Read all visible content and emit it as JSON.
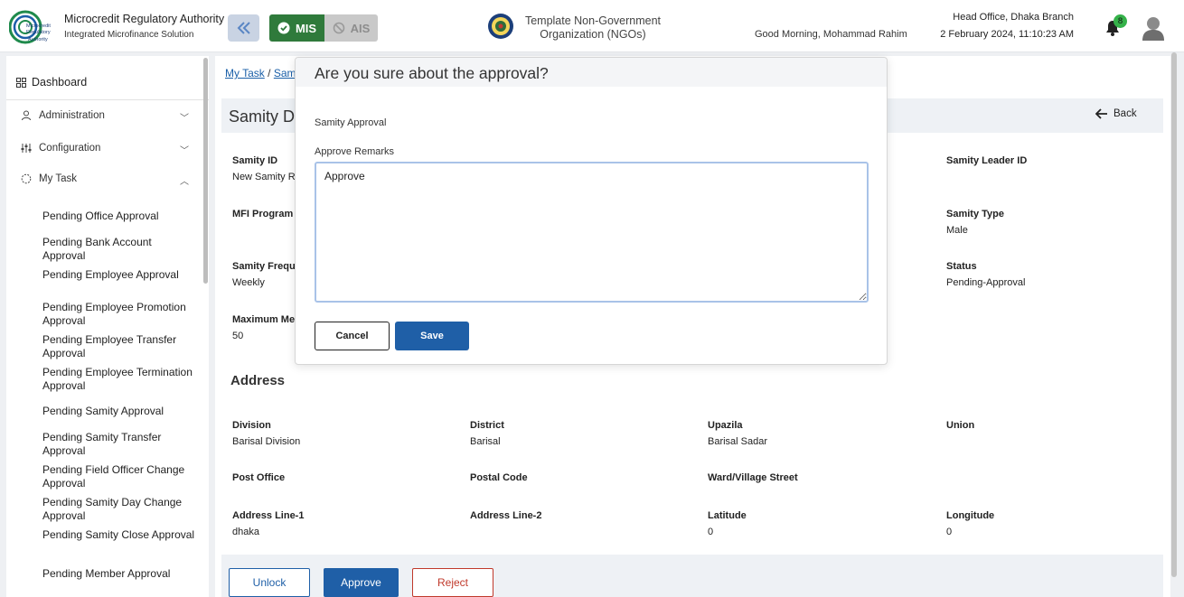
{
  "header": {
    "org_name": "Microcredit Regulatory Authority",
    "org_sub": "Integrated Microfinance Solution",
    "logo_text_lines": [
      "Microcredit",
      "Regulatory",
      "Authority"
    ],
    "mode_mis": "MIS",
    "mode_ais": "AIS",
    "ngo_title_1": "Template Non-Government",
    "ngo_title_2": "Organization (NGOs)",
    "greeting": "Good Morning, Mohammad Rahim",
    "branch": "Head Office, Dhaka Branch",
    "datetime": "2 February 2024, 11:10:23 AM",
    "notification_count": "8",
    "accent": "#1f5fa7",
    "mis_color": "#2f7a3b"
  },
  "sidebar": {
    "dashboard": "Dashboard",
    "groups": [
      {
        "label": "Administration",
        "expanded": false
      },
      {
        "label": "Configuration",
        "expanded": false
      },
      {
        "label": "My Task",
        "expanded": true
      }
    ],
    "items": [
      "Pending Office Approval",
      "Pending Bank Account Approval",
      "Pending Employee Approval",
      "Pending Employee Promotion Approval",
      "Pending Employee Transfer Approval",
      "Pending Employee Termination Approval",
      "Pending Samity Approval",
      "Pending Samity Transfer Approval",
      "Pending Field Officer Change Approval",
      "Pending Samity Day Change Approval",
      "Pending Samity Close Approval",
      "Pending Member Approval"
    ]
  },
  "breadcrumb": {
    "first": "My Task",
    "separator": "/",
    "second": "Sam"
  },
  "page": {
    "title": "Samity De",
    "back": "Back",
    "fields": {
      "samity_id_label": "Samity ID",
      "samity_id_value": "New Samity Re",
      "samity_leader_label": "Samity Leader ID",
      "mfi_program_label": "MFI Program",
      "samity_type_label": "Samity Type",
      "samity_type_value": "Male",
      "samity_frequency_label": "Samity Frequer",
      "samity_frequency_value": "Weekly",
      "status_label": "Status",
      "status_value": "Pending-Approval",
      "max_member_label": "Maximum Mem",
      "max_member_value": "50"
    },
    "address": {
      "title": "Address",
      "division_label": "Division",
      "division_value": "Barisal Division",
      "district_label": "District",
      "district_value": "Barisal",
      "upazila_label": "Upazila",
      "upazila_value": "Barisal Sadar",
      "union_label": "Union",
      "post_office_label": "Post Office",
      "postal_code_label": "Postal Code",
      "ward_label": "Ward/Village Street",
      "address1_label": "Address Line-1",
      "address1_value": "dhaka",
      "address2_label": "Address Line-2",
      "latitude_label": "Latitude",
      "latitude_value": "0",
      "longitude_label": "Longitude",
      "longitude_value": "0"
    },
    "actions": {
      "unlock": "Unlock",
      "approve": "Approve",
      "reject": "Reject"
    }
  },
  "modal": {
    "title": "Are you sure about the approval?",
    "subtitle": "Samity Approval",
    "remarks_label": "Approve Remarks",
    "remarks_value": "Approve",
    "cancel": "Cancel",
    "save": "Save"
  }
}
